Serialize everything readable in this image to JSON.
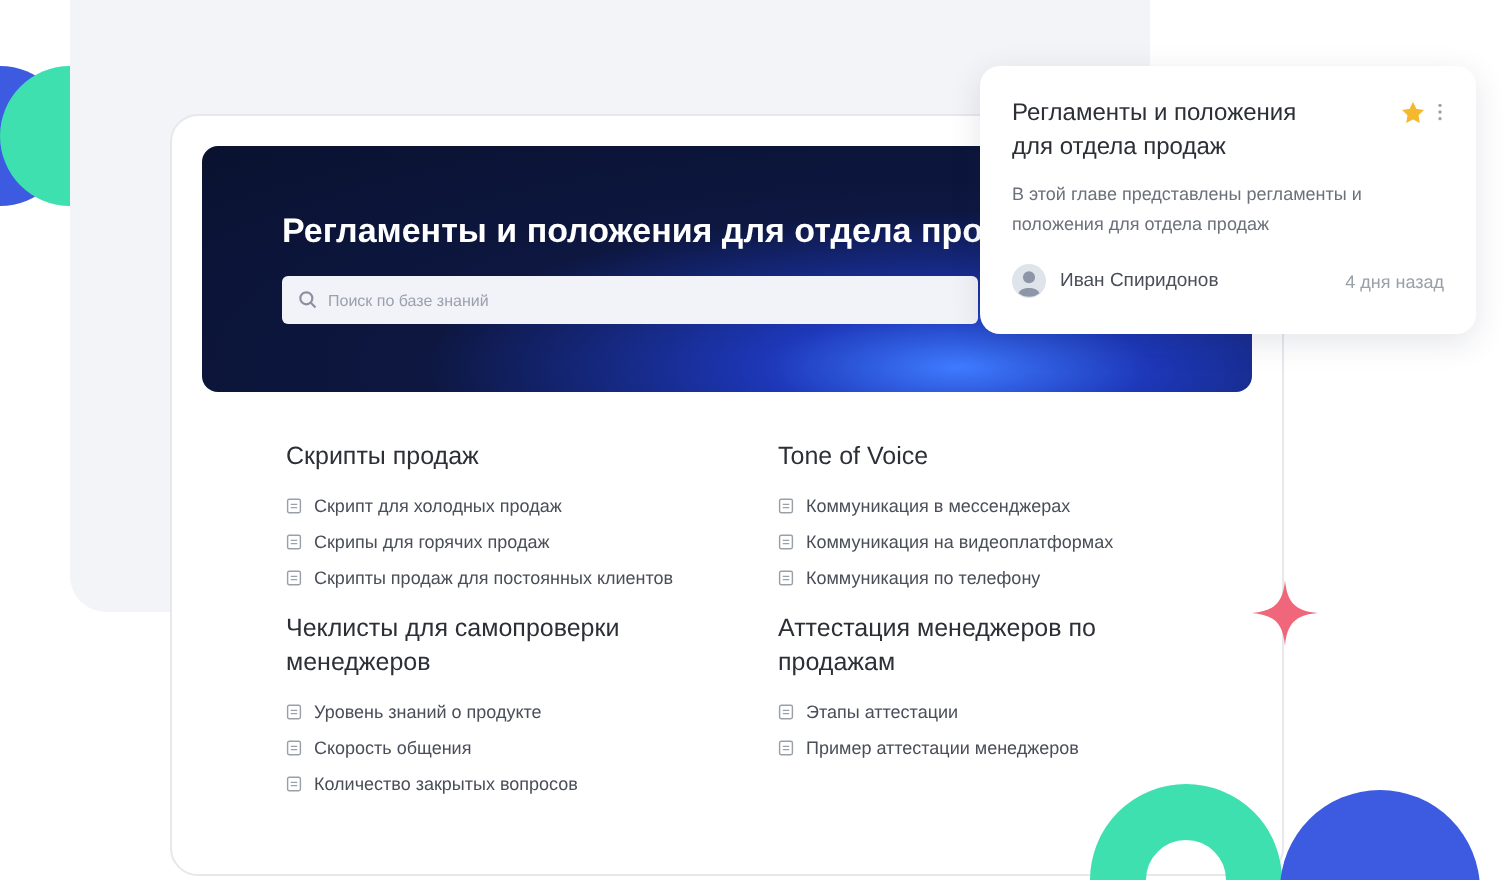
{
  "banner": {
    "title": "Регламенты и положения для отдела про",
    "search": {
      "placeholder": "Поиск по базе знаний"
    }
  },
  "sections": [
    {
      "title": "Скрипты продаж",
      "items": [
        "Скрипт для холодных продаж",
        "Скрипы для горячих продаж",
        "Скрипты продаж для постоянных клиентов"
      ]
    },
    {
      "title": "Tone of Voice",
      "items": [
        "Коммуникация в мессенджерах",
        "Коммуникация на видеоплатформах",
        "Коммуникация по телефону"
      ]
    },
    {
      "title": "Чеклисты для самопроверки менеджеров",
      "items": [
        "Уровень знаний о продукте",
        "Скорость общения",
        "Количество закрытых вопросов"
      ]
    },
    {
      "title": "Аттестация менеджеров по продажам",
      "items": [
        "Этапы аттестации",
        "Пример аттестации менеджеров"
      ]
    }
  ],
  "card": {
    "title": "Регламенты и положения для отдела продаж",
    "starred": true,
    "description": "В этой главе представлены регламенты и положения для отдела продаж",
    "author": "Иван Спиридонов",
    "time": "4 дня назад"
  }
}
